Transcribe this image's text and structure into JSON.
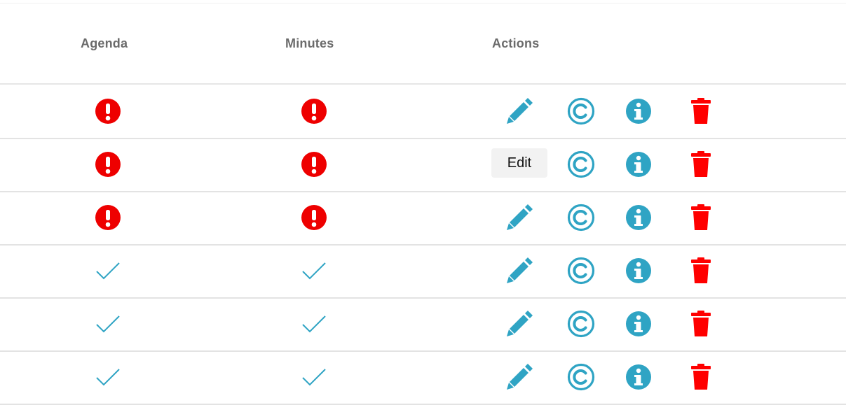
{
  "table": {
    "headers": {
      "agenda": "Agenda",
      "minutes": "Minutes",
      "actions": "Actions"
    },
    "rows": [
      {
        "agenda": "warning",
        "minutes": "warning"
      },
      {
        "agenda": "warning",
        "minutes": "warning"
      },
      {
        "agenda": "warning",
        "minutes": "warning"
      },
      {
        "agenda": "check",
        "minutes": "check"
      },
      {
        "agenda": "check",
        "minutes": "check"
      },
      {
        "agenda": "check",
        "minutes": "check"
      }
    ],
    "actions": [
      "pencil-icon",
      "copyright-icon",
      "info-icon",
      "trash-icon"
    ]
  },
  "tooltip": {
    "text": "Edit"
  },
  "colors": {
    "warning": "#ee0000",
    "accent": "#2fa4c4",
    "delete": "#ff0000",
    "header_text": "#6b6b6b"
  }
}
